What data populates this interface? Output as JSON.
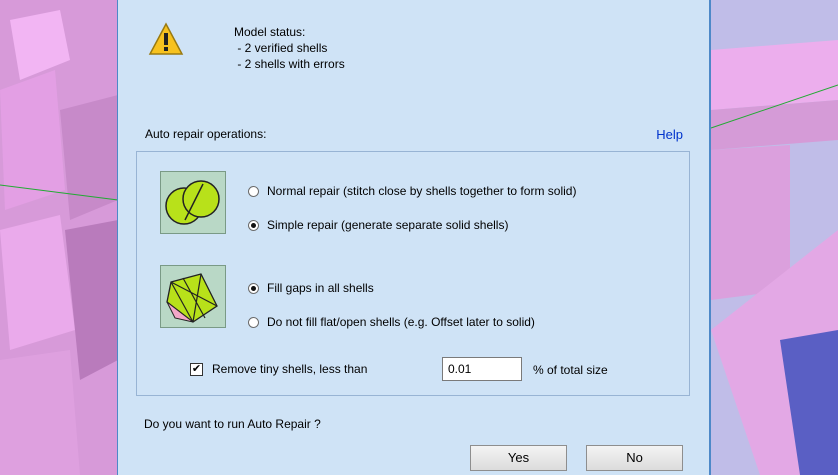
{
  "status": {
    "title": "Model status:",
    "lines": [
      " - 2 verified shells",
      " - 2 shells with errors"
    ]
  },
  "auto_repair": {
    "label": "Auto repair operations:",
    "help": "Help",
    "repair_mode": {
      "normal": "Normal repair (stitch close by shells together to form solid)",
      "simple": "Simple repair (generate separate solid shells)",
      "selected": "simple"
    },
    "fill_mode": {
      "fill_all": "Fill gaps in all shells",
      "no_fill": "Do not fill flat/open shells (e.g. Offset later to solid)",
      "selected": "fill_all"
    },
    "remove_tiny": {
      "label": "Remove tiny shells, less than",
      "checked": true,
      "value": "0.01",
      "suffix": "% of total size"
    }
  },
  "question": "Do you want to run Auto Repair ?",
  "buttons": {
    "yes": "Yes",
    "no": "No"
  },
  "colors": {
    "dialog_bg": "#cfe3f6",
    "link": "#0033cc",
    "model": "#e7a6e8"
  }
}
